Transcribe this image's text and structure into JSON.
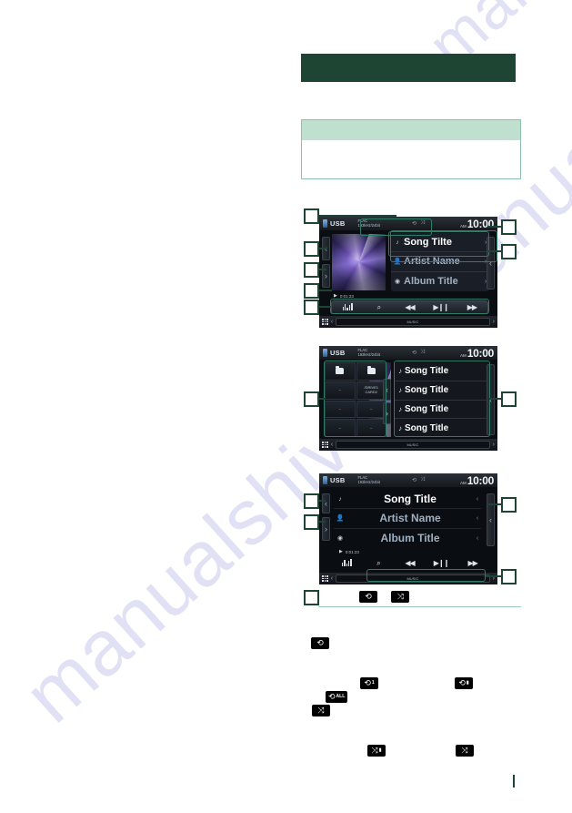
{
  "document": {
    "watermark": "manualshive",
    "banner_color": "#1e4434",
    "note_head_color": "#bfe0ce",
    "highlight_color": "#2e7d68"
  },
  "screens": [
    {
      "id": "screen-basic-control",
      "source_label": "USB",
      "format_line1": "FLAC",
      "format_line2": "192kHz/24bit",
      "clock_ampm": "AM",
      "clock_time": "10:00",
      "repeat_icon": "repeat-icon",
      "shuffle_icon": "shuffle-icon",
      "elapsed_time": "0:01:23",
      "meta_rows": [
        {
          "icon": "music-note-icon",
          "text": "Song Tilte",
          "dim": false
        },
        {
          "icon": "artist-icon",
          "text": "Artist Name",
          "dim": true
        },
        {
          "icon": "album-icon",
          "text": "Album Title",
          "dim": true
        }
      ],
      "controls": [
        {
          "name": "equalizer-button",
          "glyph": "eq"
        },
        {
          "name": "search-button",
          "glyph": "⌕"
        },
        {
          "name": "previous-track-button",
          "glyph": "◀◀"
        },
        {
          "name": "play-pause-button",
          "glyph": "▶❙❙"
        },
        {
          "name": "next-track-button",
          "glyph": "▶▶"
        }
      ],
      "source_bar_label": "MUSIC",
      "left_flaps": [
        "‹",
        "›"
      ],
      "right_flap": "‹"
    },
    {
      "id": "screen-file-list",
      "source_label": "USB",
      "format_line1": "FLAC",
      "format_line2": "192kHz/24bit",
      "clock_ampm": "AM",
      "clock_time": "10:00",
      "folder_cells": [
        {
          "type": "folder",
          "label": ""
        },
        {
          "type": "folder",
          "label": ""
        },
        {
          "type": "text",
          "label": "–"
        },
        {
          "type": "text",
          "label": "/DRIVE1\nCARD2"
        },
        {
          "type": "text",
          "label": "–"
        },
        {
          "type": "text",
          "label": "–"
        },
        {
          "type": "text",
          "label": "–"
        },
        {
          "type": "text",
          "label": "–"
        }
      ],
      "tracks": [
        {
          "icon": "music-note-icon",
          "title": "Song Title"
        },
        {
          "icon": "music-note-icon",
          "title": "Song Title"
        },
        {
          "icon": "music-note-icon",
          "title": "Song Title"
        },
        {
          "icon": "music-note-icon",
          "title": "Song Title"
        }
      ],
      "source_bar_label": "MUSIC",
      "right_flap": "›"
    },
    {
      "id": "screen-text-view",
      "source_label": "USB",
      "format_line1": "FLAC",
      "format_line2": "192kHz/24bit",
      "clock_ampm": "AM",
      "clock_time": "10:00",
      "elapsed_time": "0:01:23",
      "meta_rows": [
        {
          "icon": "music-note-icon",
          "text": "Song Title",
          "dim": false
        },
        {
          "icon": "artist-icon",
          "text": "Artist Name",
          "dim": true
        },
        {
          "icon": "album-icon",
          "text": "Album Title",
          "dim": true
        }
      ],
      "controls": [
        {
          "name": "equalizer-button",
          "glyph": "eq"
        },
        {
          "name": "search-button",
          "glyph": "⌕"
        },
        {
          "name": "previous-track-button",
          "glyph": "◀◀"
        },
        {
          "name": "play-pause-button",
          "glyph": "▶❙❙"
        },
        {
          "name": "next-track-button",
          "glyph": "▶▶"
        }
      ],
      "source_bar_label": "MUSIC",
      "left_flaps": [
        "‹",
        "›"
      ],
      "right_flap": "‹"
    }
  ],
  "inline_badges": {
    "row_repeat": {
      "name": "repeat-icon",
      "glyph": "⟲",
      "sub": ""
    },
    "row_shuffle": {
      "name": "shuffle-icon",
      "glyph": "⤨",
      "sub": ""
    },
    "repeat_plain": {
      "name": "repeat-icon",
      "glyph": "⟲",
      "sub": ""
    },
    "repeat_one": {
      "name": "repeat-one-icon",
      "glyph": "⟲",
      "sub": "1"
    },
    "repeat_folder": {
      "name": "repeat-folder-icon",
      "glyph": "⟲",
      "sub": "▮"
    },
    "repeat_all": {
      "name": "repeat-all-icon",
      "glyph": "⟲",
      "sub": "ALL"
    },
    "shuffle_plain": {
      "name": "shuffle-icon",
      "glyph": "⤨",
      "sub": ""
    },
    "shuffle_folder": {
      "name": "shuffle-folder-icon",
      "glyph": "⤨",
      "sub": "▮"
    },
    "shuffle_all": {
      "name": "shuffle-all-icon",
      "glyph": "⤨",
      "sub": ""
    }
  },
  "callouts": {
    "label": ""
  }
}
